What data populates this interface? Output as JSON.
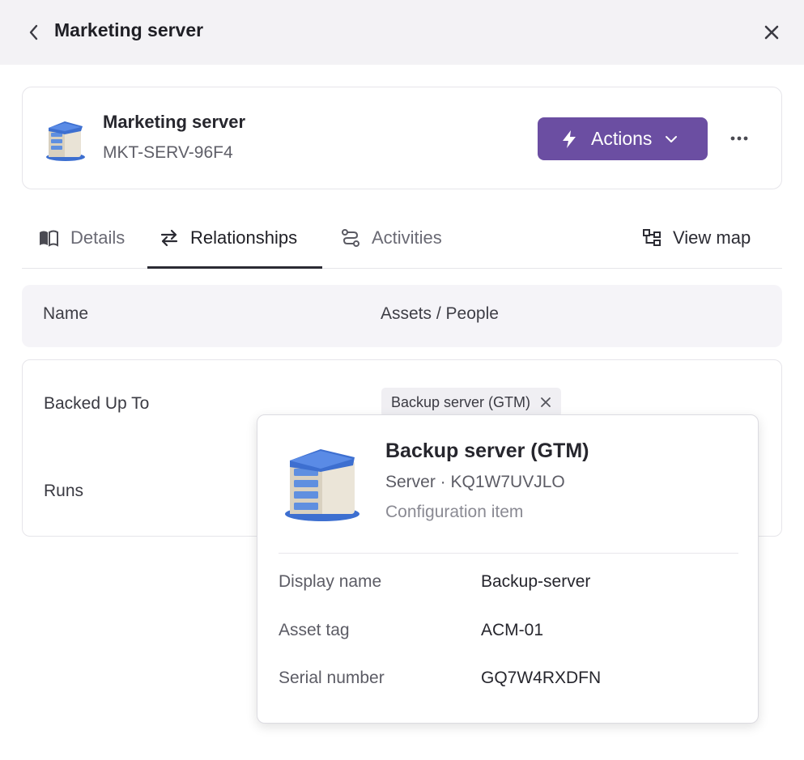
{
  "header": {
    "title": "Marketing server"
  },
  "asset": {
    "name": "Marketing server",
    "id": "MKT-SERV-96F4",
    "actions_label": "Actions"
  },
  "tabs": [
    {
      "label": "Details",
      "icon": "book-icon",
      "active": false
    },
    {
      "label": "Relationships",
      "icon": "swap-arrows-icon",
      "active": true
    },
    {
      "label": "Activities",
      "icon": "activity-flow-icon",
      "active": false
    }
  ],
  "view_map_label": "View map",
  "table": {
    "columns": [
      "Name",
      "Assets / People"
    ],
    "rows": [
      {
        "name": "Backed Up To",
        "chip": "Backup server (GTM)"
      },
      {
        "name": "Runs"
      }
    ]
  },
  "popover": {
    "title": "Backup server (GTM)",
    "subtitle": "Server · KQ1W7UVJLO",
    "type": "Configuration item",
    "fields": [
      {
        "label": "Display name",
        "value": "Backup-server"
      },
      {
        "label": "Asset tag",
        "value": "ACM-01"
      },
      {
        "label": "Serial number",
        "value": "GQ7W4RXDFN"
      }
    ]
  },
  "colors": {
    "accent": "#6b4ea2",
    "header_bg": "#f3f2f5",
    "table_header_bg": "#f5f4f8"
  }
}
